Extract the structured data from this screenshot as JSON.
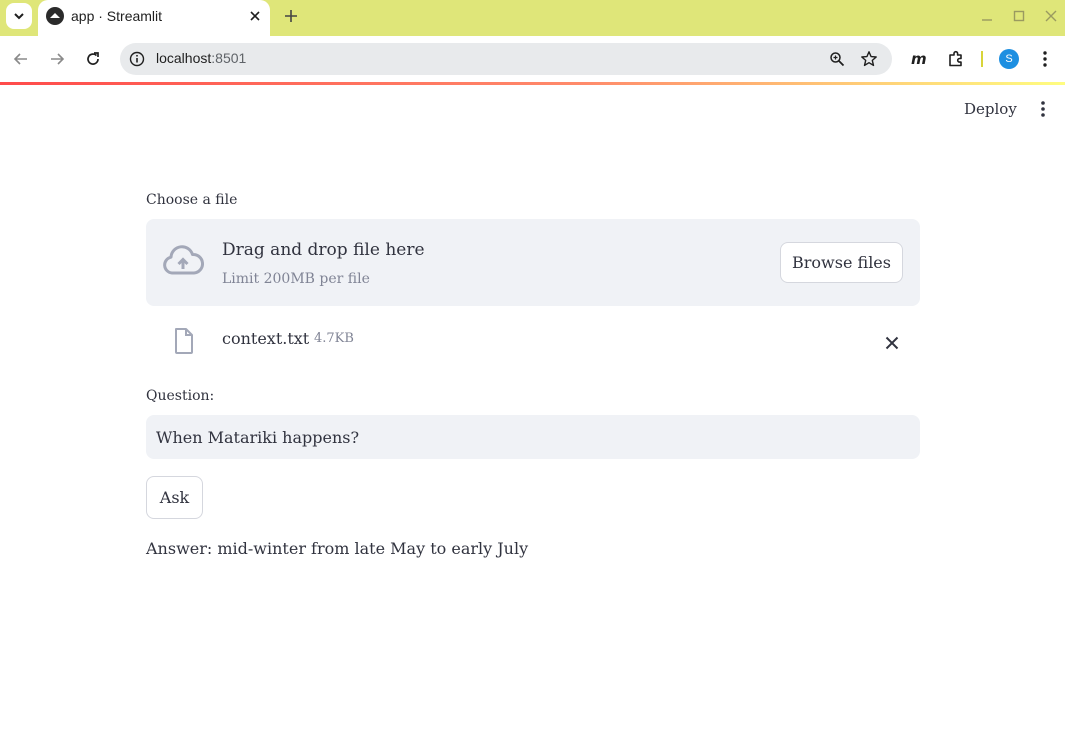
{
  "browser": {
    "tab_title": "app · Streamlit",
    "url_host": "localhost",
    "url_port": ":8501",
    "profile_initial": "S"
  },
  "app": {
    "deploy_label": "Deploy",
    "uploader": {
      "label": "Choose a file",
      "drop_title": "Drag and drop file here",
      "drop_limit": "Limit 200MB per file",
      "browse_label": "Browse files"
    },
    "uploaded_file": {
      "name": "context.txt",
      "size": "4.7KB"
    },
    "question": {
      "label": "Question:",
      "value": "When Matariki happens?"
    },
    "ask_label": "Ask",
    "answer_text": "Answer: mid-winter from late May to early July"
  },
  "colors": {
    "tabstrip": "#dfe679",
    "text": "#31333f",
    "muted": "#808495",
    "input_bg": "#f0f2f6",
    "accent": "#ff4b4b"
  }
}
